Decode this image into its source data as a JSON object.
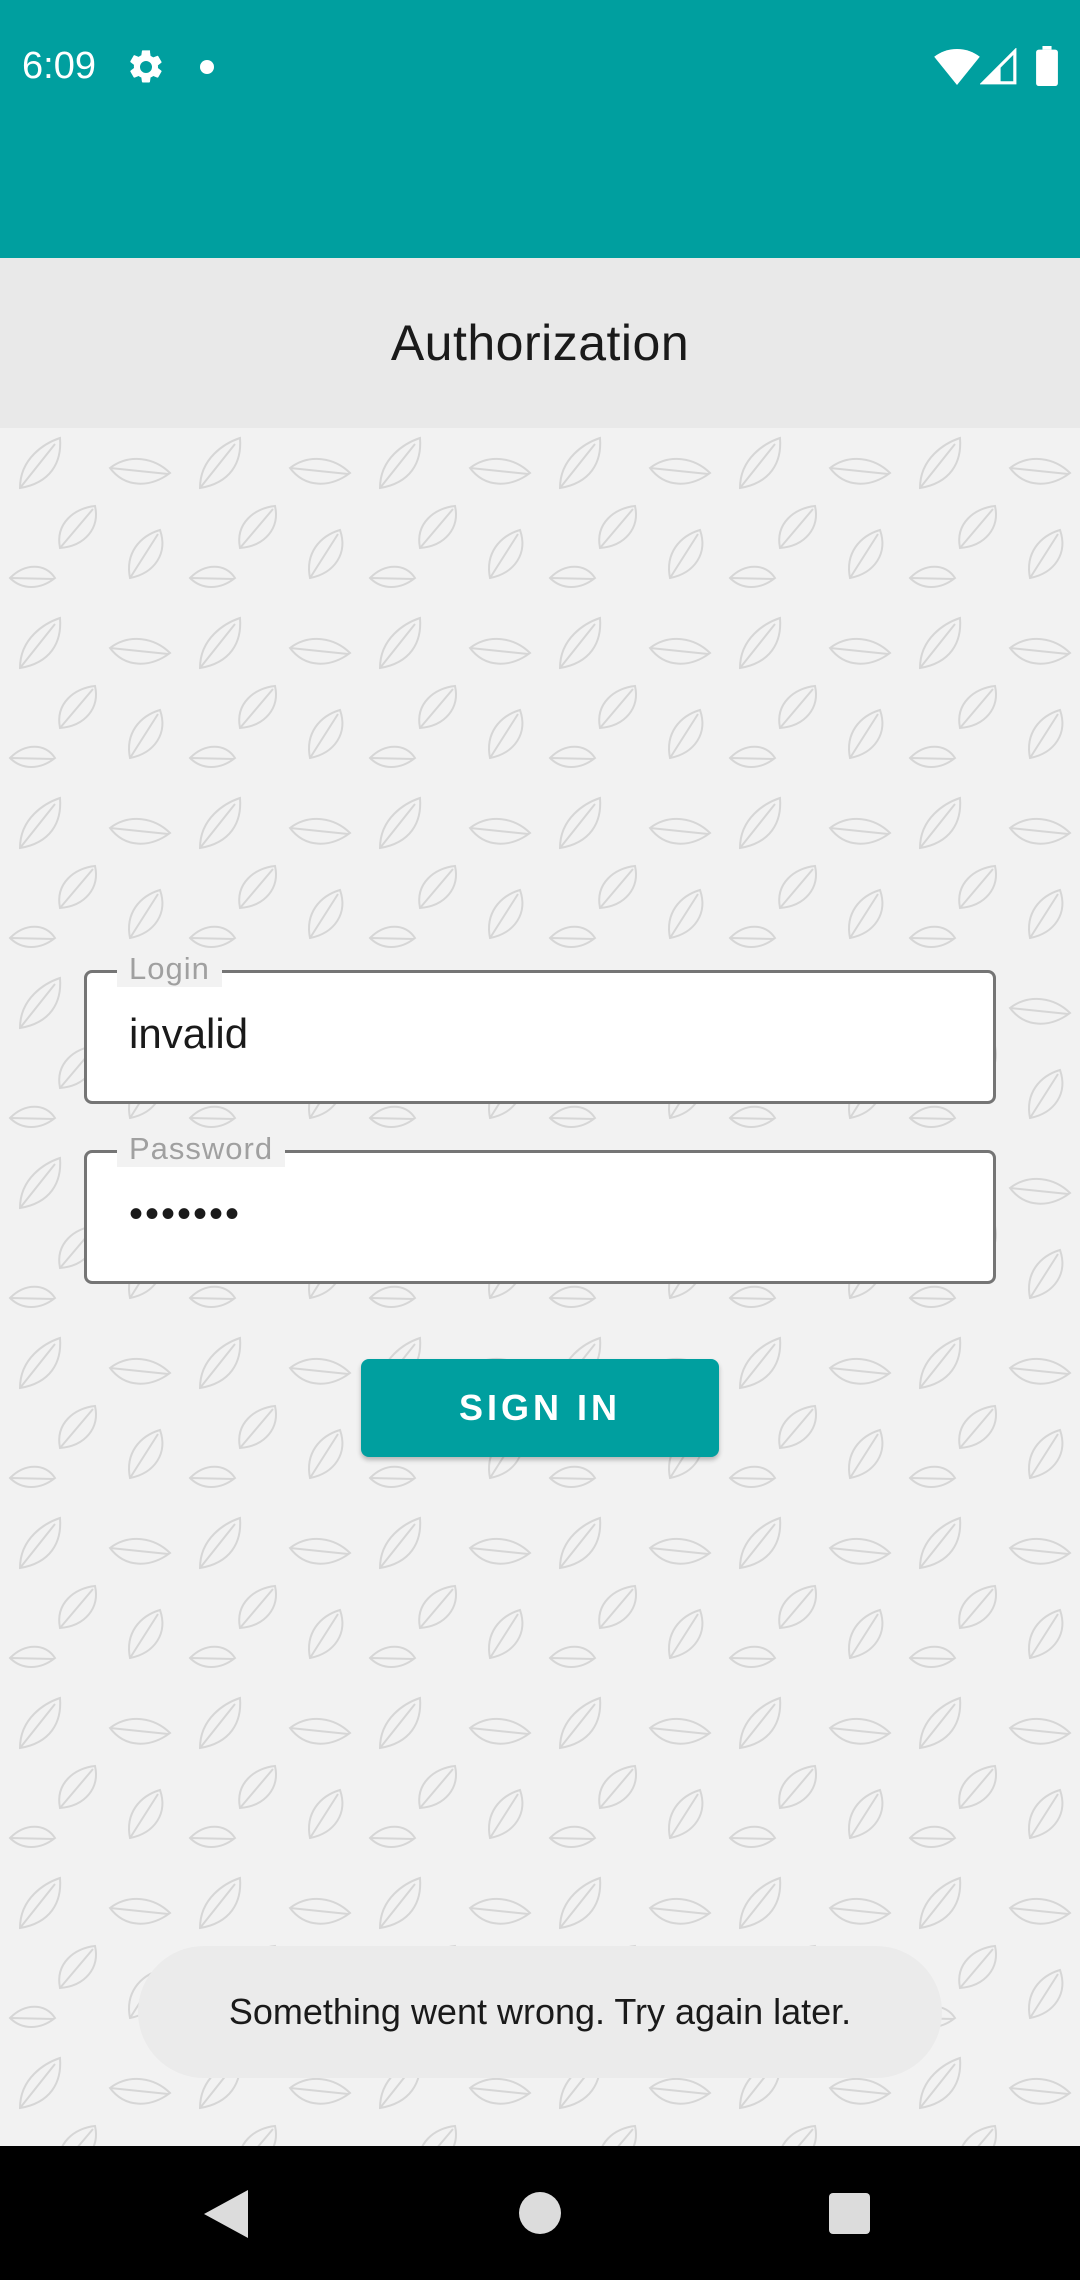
{
  "status_bar": {
    "time": "6:09",
    "icons": [
      "gear-icon",
      "notification-dot-icon",
      "wifi-icon",
      "cell-signal-icon",
      "battery-icon"
    ],
    "background_color": "#009f9f"
  },
  "app_bar": {
    "title": "Authorization"
  },
  "form": {
    "login": {
      "label": "Login",
      "value": "invalid"
    },
    "password": {
      "label": "Password",
      "value": "•••••••"
    },
    "signin_label": "SIGN IN"
  },
  "toast": {
    "message": "Something went wrong. Try again later."
  },
  "nav_bar": {
    "icons": [
      "back-icon",
      "home-icon",
      "recents-icon"
    ]
  },
  "colors": {
    "accent": "#009f9f",
    "background": "#f2f2f2",
    "app_bar": "#e9e9e9"
  }
}
